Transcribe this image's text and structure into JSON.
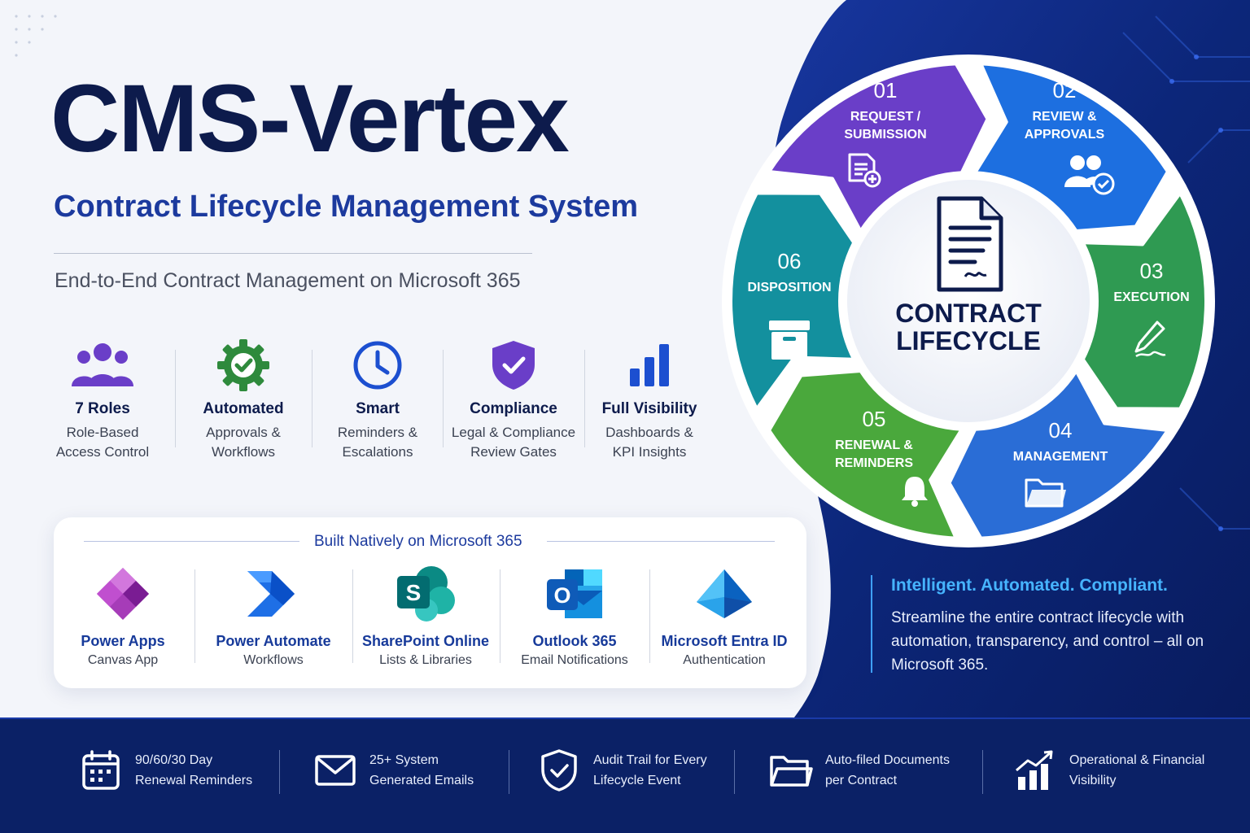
{
  "brand": {
    "title": "CMS-Vertex",
    "subtitle": "Contract Lifecycle Management System",
    "tagline": "End-to-End Contract Management on Microsoft 365"
  },
  "features": [
    {
      "icon": "users-icon",
      "title": "7 Roles",
      "line1": "Role-Based",
      "line2": "Access Control"
    },
    {
      "icon": "gear-check-icon",
      "title": "Automated",
      "line1": "Approvals &",
      "line2": "Workflows"
    },
    {
      "icon": "clock-icon",
      "title": "Smart",
      "line1": "Reminders &",
      "line2": "Escalations"
    },
    {
      "icon": "shield-check-icon",
      "title": "Compliance",
      "line1": "Legal & Compliance",
      "line2": "Review Gates"
    },
    {
      "icon": "bar-chart-icon",
      "title": "Full Visibility",
      "line1": "Dashboards &",
      "line2": "KPI Insights"
    }
  ],
  "m365": {
    "title": "Built Natively on Microsoft 365",
    "apps": [
      {
        "icon": "power-apps-icon",
        "name": "Power Apps",
        "desc": "Canvas App"
      },
      {
        "icon": "power-automate-icon",
        "name": "Power Automate",
        "desc": "Workflows"
      },
      {
        "icon": "sharepoint-icon",
        "name": "SharePoint Online",
        "desc": "Lists & Libraries",
        "letter": "S"
      },
      {
        "icon": "outlook-icon",
        "name": "Outlook 365",
        "desc": "Email Notifications",
        "letter": "O"
      },
      {
        "icon": "entra-id-icon",
        "name": "Microsoft Entra ID",
        "desc": "Authentication"
      }
    ]
  },
  "lifecycle": {
    "center_line1": "CONTRACT",
    "center_line2": "LIFECYCLE",
    "stages": [
      {
        "num": "01",
        "line1": "REQUEST /",
        "line2": "SUBMISSION",
        "color": "#6a3ec8",
        "icon": "document-plus-icon"
      },
      {
        "num": "02",
        "line1": "REVIEW &",
        "line2": "APPROVALS",
        "color": "#1d6fe0",
        "icon": "users-check-icon"
      },
      {
        "num": "03",
        "line1": "EXECUTION",
        "line2": "",
        "color": "#2f9a52",
        "icon": "pen-icon"
      },
      {
        "num": "04",
        "line1": "MANAGEMENT",
        "line2": "",
        "color": "#2a6dd6",
        "icon": "folder-icon"
      },
      {
        "num": "05",
        "line1": "RENEWAL &",
        "line2": "REMINDERS",
        "color": "#4aa83c",
        "icon": "bell-icon"
      },
      {
        "num": "06",
        "line1": "DISPOSITION",
        "line2": "",
        "color": "#13909e",
        "icon": "archive-box-icon"
      }
    ]
  },
  "intel": {
    "headline": "Intelligent. Automated. Compliant.",
    "body": "Streamline the entire contract lifecycle with automation, transparency, and control – all on Microsoft 365."
  },
  "footer": [
    {
      "icon": "calendar-icon",
      "line1": "90/60/30 Day",
      "line2": "Renewal Reminders"
    },
    {
      "icon": "envelope-icon",
      "line1": "25+ System",
      "line2": "Generated Emails"
    },
    {
      "icon": "shield-check-icon",
      "line1": "Audit Trail for Every",
      "line2": "Lifecycle Event"
    },
    {
      "icon": "folder-icon",
      "line1": "Auto-filed Documents",
      "line2": "per Contract"
    },
    {
      "icon": "growth-chart-icon",
      "line1": "Operational & Financial",
      "line2": "Visibility"
    }
  ],
  "colors": {
    "navy": "#0d1b4c",
    "royal": "#1c3a9e",
    "dark_panel": "#0b2370",
    "accent_cyan": "#46b4ff"
  }
}
